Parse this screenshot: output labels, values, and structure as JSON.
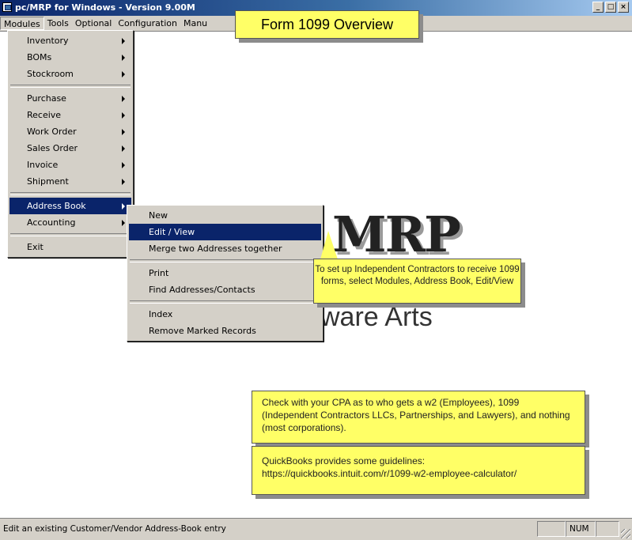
{
  "window": {
    "title": "pc/MRP for Windows - Version 9.00M",
    "controls": [
      "_",
      "□",
      "×"
    ]
  },
  "menubar": {
    "items": [
      "Modules",
      "Tools",
      "Optional",
      "Configuration",
      "Manu"
    ]
  },
  "modules_menu": {
    "items": [
      {
        "label": "Inventory",
        "submenu": true
      },
      {
        "label": "BOMs",
        "submenu": true
      },
      {
        "label": "Stockroom",
        "submenu": true
      },
      {
        "label": "Purchase",
        "submenu": true
      },
      {
        "label": "Receive",
        "submenu": true
      },
      {
        "label": "Work Order",
        "submenu": true
      },
      {
        "label": "Sales Order",
        "submenu": true
      },
      {
        "label": "Invoice",
        "submenu": true
      },
      {
        "label": "Shipment",
        "submenu": true
      },
      {
        "label": "Address Book",
        "submenu": true,
        "selected": true
      },
      {
        "label": "Accounting",
        "submenu": true
      },
      {
        "label": "Exit",
        "submenu": false
      }
    ]
  },
  "address_book_submenu": {
    "items": [
      {
        "label": "New"
      },
      {
        "label": "Edit / View",
        "selected": true
      },
      {
        "label": "Merge two Addresses together"
      },
      {
        "label": "Print"
      },
      {
        "label": "Find Addresses/Contacts"
      },
      {
        "label": "Index"
      },
      {
        "label": "Remove Marked Records"
      }
    ]
  },
  "background": {
    "logo": "MRP",
    "subtitle": "ware Arts"
  },
  "callouts": {
    "form_overview": "Form 1099 Overview",
    "contractors": "To set up Independent Contractors to receive 1099 forms, select Modules, Address Book, Edit/View",
    "cpa": "Check with your CPA as to who gets a w2 (Employees), 1099 (Independent Contractors LLCs, Partnerships, and Lawyers), and nothing (most corporations).",
    "quickbooks_line1": "QuickBooks provides some guidelines:",
    "quickbooks_line2": "https://quickbooks.intuit.com/r/1099-w2-employee-calculator/"
  },
  "statusbar": {
    "message": "Edit an existing Customer/Vendor Address-Book entry",
    "num_indicator": "NUM"
  },
  "colors": {
    "title_active": "#0a246a",
    "menu_face": "#d4d0c8",
    "callout_yellow": "#ffff66"
  }
}
